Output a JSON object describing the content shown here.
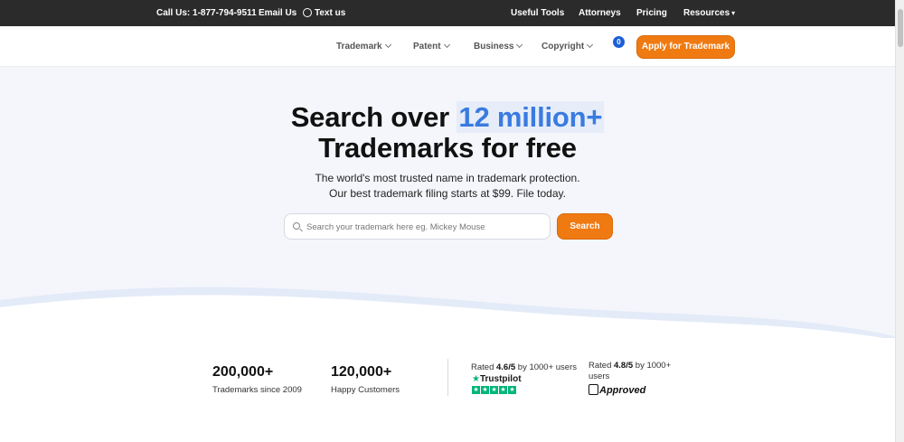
{
  "topbar": {
    "call_us": "Call Us: 1-877-794-9511",
    "email_us": "Email Us",
    "text_us": "Text us",
    "useful_tools": "Useful Tools",
    "attorneys": "Attorneys",
    "pricing": "Pricing",
    "resources": "Resources"
  },
  "nav": {
    "trademark": "Trademark",
    "patent": "Patent",
    "business": "Business",
    "copyright": "Copyright",
    "cart_count": "0",
    "apply_button": "Apply for Trademark"
  },
  "hero": {
    "headline_part1": "Search over ",
    "headline_highlight": "12 million+",
    "headline_line2": "Trademarks for free",
    "sub_line1": "The world's most trusted name in trademark protection.",
    "sub_line2": "Our best trademark filing starts at $99. File today.",
    "search_placeholder": "Search your trademark here eg. Mickey Mouse",
    "search_button": "Search"
  },
  "stats": [
    {
      "value": "200,000+",
      "label": "Trademarks since 2009"
    },
    {
      "value": "120,000+",
      "label": "Happy Customers"
    }
  ],
  "ratings": {
    "trustpilot_prefix": "Rated ",
    "trustpilot_score": "4.6/5",
    "trustpilot_suffix": " by 1000+ users",
    "trustpilot_name": "Trustpilot",
    "shopper_prefix": "Rated ",
    "shopper_score": "4.8/5",
    "shopper_suffix": " by 1000+",
    "shopper_suffix2": "users",
    "shopper_name": "Approved"
  },
  "colors": {
    "accent_orange": "#f07a12",
    "highlight_blue": "#3a7be0",
    "topbar_bg": "#2b2b2b",
    "hero_bg": "#f4f6fb",
    "trustpilot_green": "#00b67a"
  }
}
